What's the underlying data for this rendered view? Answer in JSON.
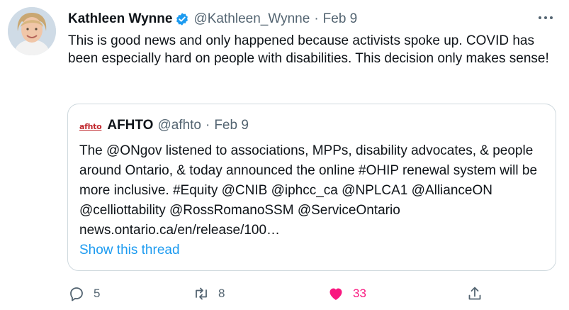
{
  "tweet": {
    "author_name": "Kathleen Wynne",
    "handle": "@Kathleen_Wynne",
    "separator": "·",
    "date": "Feb 9",
    "text": "This is good news and only happened because activists spoke up. COVID has been especially hard on people with disabilities. This decision only makes sense!",
    "verified_color": "#1d9bf0"
  },
  "quote": {
    "logo_text": "afhto",
    "author_name": "AFHTO",
    "handle": "@afhto",
    "separator": "·",
    "date": "Feb 9",
    "text": "The @ONgov listened to associations, MPPs, disability advocates, & people around Ontario, & today announced the online #OHIP renewal system will be more inclusive. #Equity @CNIB @iphcc_ca @NPLCA1 @AllianceON @celliottability @RossRomanoSSM @ServiceOntario news.ontario.ca/en/release/100…",
    "show_thread": "Show this thread"
  },
  "actions": {
    "reply": {
      "icon": "reply-icon",
      "count": "5"
    },
    "retweet": {
      "icon": "retweet-icon",
      "count": "8"
    },
    "like": {
      "icon": "heart-icon",
      "count": "33",
      "liked": true,
      "color": "#f91880"
    },
    "share": {
      "icon": "share-icon"
    }
  }
}
